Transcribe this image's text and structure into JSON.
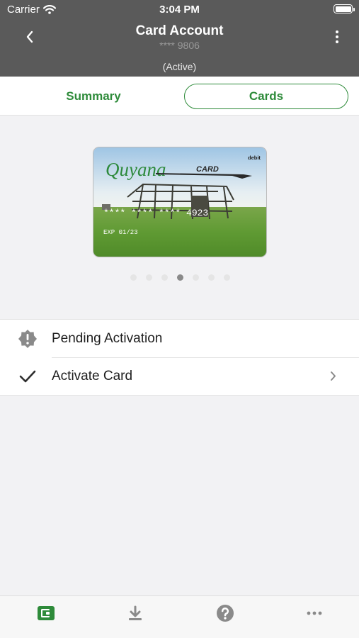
{
  "status_bar": {
    "carrier": "Carrier",
    "time": "3:04 PM"
  },
  "header": {
    "title": "Card Account",
    "account_mask": "**** 9806",
    "status": "(Active)"
  },
  "tabs": [
    {
      "label": "Summary",
      "selected": false
    },
    {
      "label": "Cards",
      "selected": true
    }
  ],
  "card": {
    "brand": "Quyana",
    "brand_suffix": "CARD",
    "type": "debit",
    "number": "**** **** **** 4923",
    "expiry": "EXP 01/23"
  },
  "carousel": {
    "page_count": 7,
    "current_page": 4
  },
  "list": [
    {
      "label": "Pending Activation",
      "icon": "warning-badge-icon"
    },
    {
      "label": "Activate Card",
      "icon": "checkmark-icon"
    }
  ],
  "bottom_tabs": [
    {
      "icon": "wallet-icon"
    },
    {
      "icon": "download-icon"
    },
    {
      "icon": "help-icon"
    },
    {
      "icon": "more-icon"
    }
  ],
  "colors": {
    "accent": "#2e8b3a",
    "header_bg": "#5a5a5a"
  }
}
